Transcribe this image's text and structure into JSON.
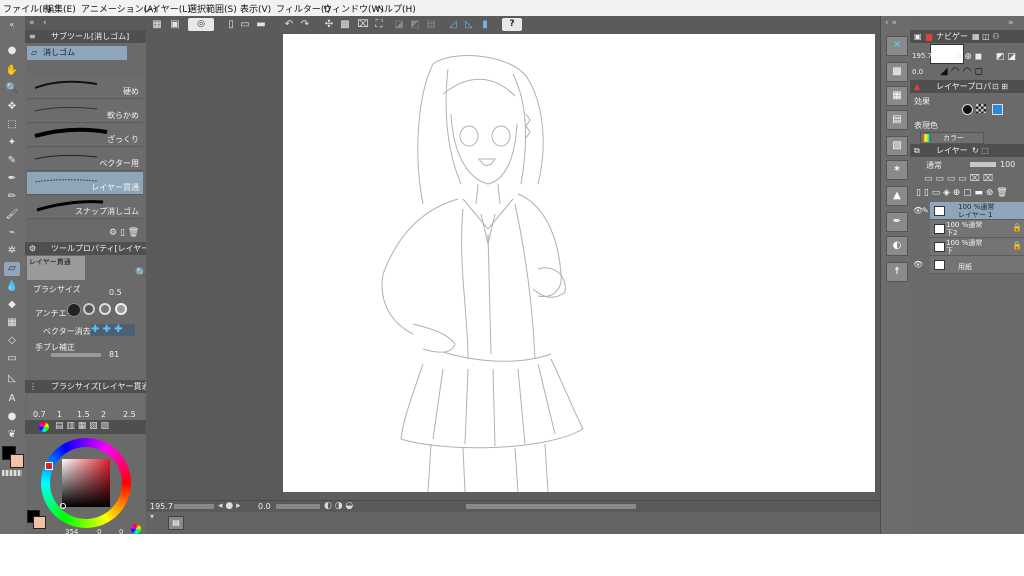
{
  "menu": [
    "ファイル(F)",
    "編集(E)",
    "アニメーション(A)",
    "レイヤー(L)",
    "選択範囲(S)",
    "表示(V)",
    "フィルター(I)",
    "ウィンドウ(W)",
    "ヘルプ(H)"
  ],
  "subtool": {
    "panel_title": "サブツール[消しゴム]",
    "group_tab": "消しゴム",
    "brushes": [
      "硬め",
      "軟らかめ",
      "ざっくり",
      "ベクター用",
      "レイヤー貫通",
      "スナップ消しゴム"
    ],
    "selected_index": 4
  },
  "tool_property": {
    "panel_title": "ツールプロパティ[レイヤー貫",
    "preview_label": "レイヤー貫通",
    "brush_size_label": "ブラシサイズ",
    "brush_size_value": "0.5",
    "antialias_label": "アンチエイ",
    "vector_erase_label": "ベクター消去",
    "stabilization_label": "手ブレ補正",
    "stabilization_value": "81"
  },
  "brush_size_panel": {
    "panel_title": "ブラシサイズ[レイヤー貫通]",
    "sizes": [
      "0.7",
      "1",
      "1.5",
      "2",
      "2.5"
    ]
  },
  "color": {
    "main": "#000000",
    "sub": "#f5c0a8",
    "readout": [
      "354",
      "0",
      "0"
    ]
  },
  "canvas_status": {
    "zoom": "195.7",
    "angle": "0.0"
  },
  "navigator": {
    "panel_title": "ナビゲー",
    "zoom": "195.7",
    "angle": "0.0"
  },
  "layer_property": {
    "panel_title": "レイヤープロパ",
    "effect_label": "効果",
    "expression_label": "表現色",
    "expression_value": "カラー"
  },
  "layers": {
    "panel_title": "レイヤー",
    "blend_mode": "通常",
    "opacity": "100",
    "items": [
      {
        "line1": "100 %通常",
        "line2": "レイヤー 1",
        "selected": true
      },
      {
        "line1": "100 %通常",
        "line2": "下2",
        "selected": false
      },
      {
        "line1": "100 %通常",
        "line2": "下",
        "selected": false
      },
      {
        "line1": "",
        "line2": "用紙",
        "selected": false
      }
    ]
  }
}
